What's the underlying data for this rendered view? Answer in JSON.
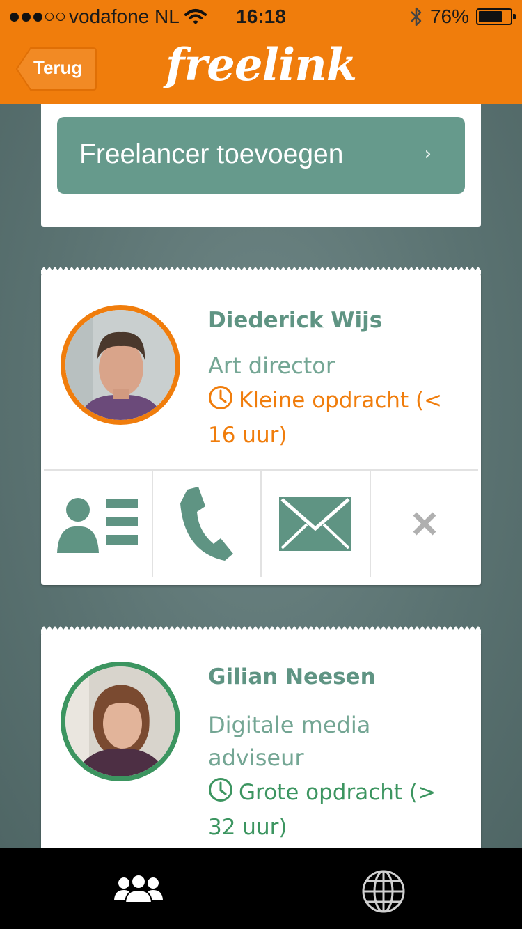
{
  "status_bar": {
    "carrier": "vodafone NL",
    "time": "16:18",
    "battery": "76%",
    "battery_level": 0.76,
    "signal_bars_filled": 3,
    "signal_bars_total": 5
  },
  "nav": {
    "back_label": "Terug",
    "logo": "freelink",
    "color": "#f07d0c"
  },
  "add_freelancer": {
    "label": "Freelancer toevoegen",
    "chevron": "›",
    "color": "#669a8c"
  },
  "freelancers": [
    {
      "name": "Diederick Wijs",
      "role": "Art director",
      "job": "Kleine opdracht (< 16 uur)",
      "status_color": "#f07d0c",
      "avatar_icon": "person-photo-icon"
    },
    {
      "name": "Gilian Neesen",
      "role": "Digitale media adviseur",
      "job": "Grote opdracht (> 32 uur)",
      "status_color": "#3c9560",
      "avatar_icon": "person-photo-icon"
    }
  ],
  "card_actions": [
    {
      "icon": "contact-card-icon"
    },
    {
      "icon": "phone-icon"
    },
    {
      "icon": "envelope-icon"
    },
    {
      "icon": "close-icon"
    }
  ],
  "tab_bar": [
    {
      "icon": "people-icon",
      "active": true
    },
    {
      "icon": "globe-icon",
      "active": false
    }
  ]
}
